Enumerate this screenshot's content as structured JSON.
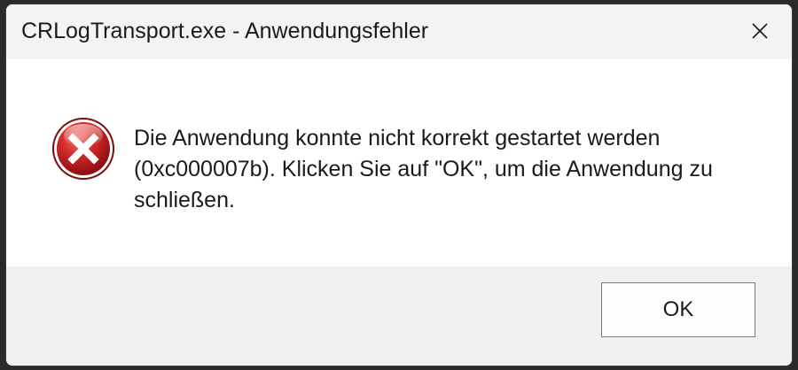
{
  "window": {
    "title": "CRLogTransport.exe - Anwendungsfehler"
  },
  "titlebar": {
    "close_icon": "close-icon"
  },
  "dialog": {
    "icon": "error-icon",
    "message": "Die Anwendung konnte nicht korrekt gestartet werden\n(0xc000007b). Klicken Sie auf \"OK\", um die Anwendung zu\nschließen."
  },
  "buttons": {
    "ok_label": "OK"
  },
  "colors": {
    "error_red": "#c8151d",
    "content_bg": "#ffffff",
    "footer_bg": "#f0f0f0"
  }
}
